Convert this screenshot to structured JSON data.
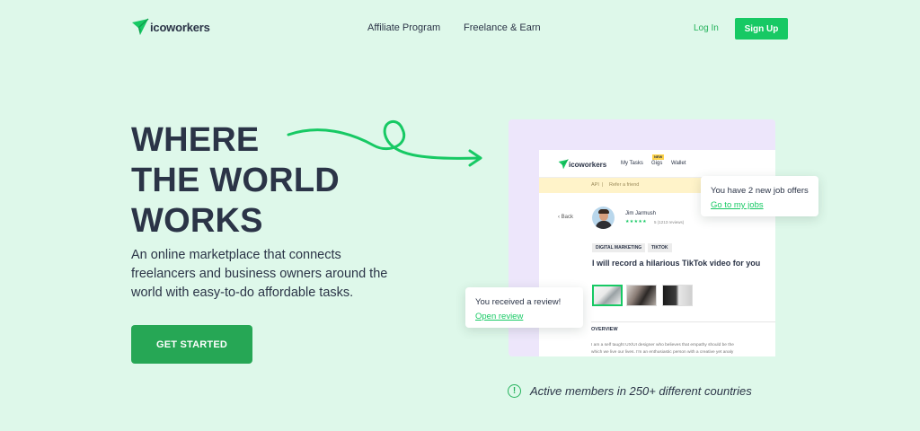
{
  "header": {
    "logo_text": "icoworkers",
    "nav": [
      "Affiliate Program",
      "Freelance & Earn"
    ],
    "login_label": "Log In",
    "signup_label": "Sign Up"
  },
  "hero": {
    "title_lines": [
      "WHERE",
      "THE WORLD",
      "WORKS"
    ],
    "subtitle": "An online marketplace that connects freelancers and business owners around the world with easy-to-do affordable tasks.",
    "cta_label": "GET STARTED"
  },
  "mockup": {
    "logo_text": "icoworkers",
    "nav": {
      "my_tasks": "My Tasks",
      "gigs": "Gigs",
      "gigs_badge": "NEW",
      "wallet": "Wallet"
    },
    "banner": {
      "api": "API",
      "separator": "|",
      "refer": "Refer a friend"
    },
    "back_label": "Back",
    "seller_name": "Jim Jarmush",
    "stars": "★★★★★",
    "rating": "5 (1213 reviews)",
    "tags": [
      "DIGITAL MARKETING",
      "TIKTOK"
    ],
    "gig_title": "I will record a hilarious TikTok video for you",
    "overview_label": "OVERVIEW",
    "overview_lines": [
      "I am a self taught UX/UI designer who believes that empathy should be the",
      "which we live our lives. I'm an enthusiastic person with a creative yet analy"
    ]
  },
  "notifications": {
    "jobs": {
      "text": "You have 2 new job offers",
      "link": "Go to my jobs"
    },
    "review": {
      "text": "You received a review!",
      "link": "Open review"
    }
  },
  "footer": {
    "info_icon": "!",
    "active_members": "Active members in 250+ different countries"
  },
  "colors": {
    "background": "#def8ea",
    "accent_green": "#17c964",
    "cta_green": "#26a755",
    "text_dark": "#2b3447",
    "mockup_lavender": "#ede6fb"
  }
}
